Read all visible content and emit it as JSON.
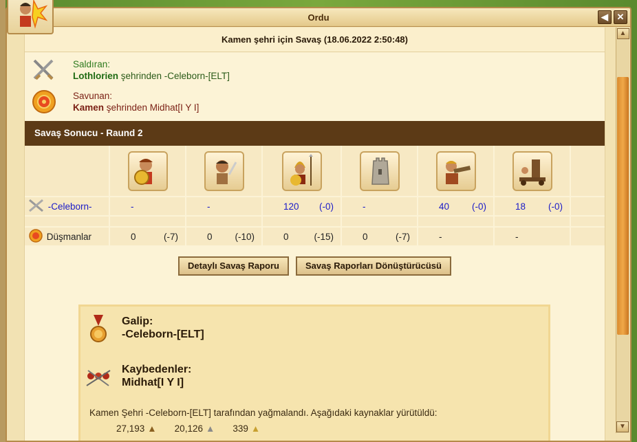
{
  "window": {
    "title": "Ordu"
  },
  "battle": {
    "title": "Kamen şehri için Savaş (18.06.2022 2:50:48)"
  },
  "attacker": {
    "label": "Saldıran:",
    "city": "Lothlorien",
    "from_text": " şehrinden -Celeborn-[ELT]"
  },
  "defender": {
    "label": "Savunan:",
    "city": "Kamen",
    "from_text": " şehrinden Midhat[I Y I]"
  },
  "result": {
    "title": "Savaş Sonucu - Raund 2"
  },
  "units": {
    "icons": [
      "hoplite-icon",
      "slinger-icon",
      "spearman-icon",
      "wall-icon",
      "gunner-icon",
      "catapult-icon"
    ],
    "attacker_row": {
      "label": "-Celeborn-",
      "cells": [
        {
          "count": "-",
          "loss": ""
        },
        {
          "count": "-",
          "loss": ""
        },
        {
          "count": "120",
          "loss": "(-0)"
        },
        {
          "count": "-",
          "loss": ""
        },
        {
          "count": "40",
          "loss": "(-0)"
        },
        {
          "count": "18",
          "loss": "(-0)"
        }
      ]
    },
    "defender_row": {
      "label": "Düşmanlar",
      "cells": [
        {
          "count": "0",
          "loss": "(-7)"
        },
        {
          "count": "0",
          "loss": "(-10)"
        },
        {
          "count": "0",
          "loss": "(-15)"
        },
        {
          "count": "0",
          "loss": "(-7)"
        },
        {
          "count": "-",
          "loss": ""
        },
        {
          "count": "-",
          "loss": ""
        }
      ]
    }
  },
  "buttons": {
    "detail": "Detaylı Savaş Raporu",
    "converter": "Savaş Raporları Dönüştürücüsü"
  },
  "summary": {
    "winner_label": "Galip:",
    "winner": "-Celeborn-[ELT]",
    "losers_label": "Kaybedenler:",
    "losers": "Midhat[I Y I]",
    "plunder_text": "Kamen Şehri -Celeborn-[ELT] tarafından yağmalandı. Aşağıdaki kaynaklar yürütüldü:",
    "resources": [
      {
        "value": "27,193",
        "icon": "wood-icon"
      },
      {
        "value": "20,126",
        "icon": "marble-icon"
      },
      {
        "value": "339",
        "icon": "wine-icon"
      }
    ]
  },
  "colors": {
    "header_bar": "#5c3a16",
    "attacker_blue": "#1b1bc8",
    "scroll_thumb": "#f0a848"
  }
}
